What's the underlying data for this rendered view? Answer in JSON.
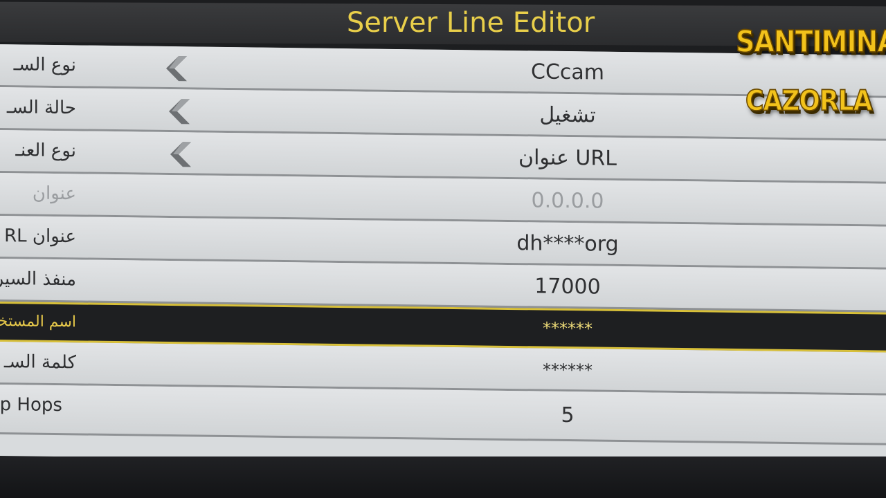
{
  "title": "Server Line Editor",
  "watermark": {
    "line1": "SANTIMINA",
    "line2": "CAZORLA"
  },
  "rows": [
    {
      "label": "نوع السـ",
      "value": "CCcam",
      "has_arrow": true,
      "state": "normal"
    },
    {
      "label": "حالة السـ",
      "value": "تشغيل",
      "has_arrow": true,
      "state": "normal"
    },
    {
      "label": "نوع العنـ",
      "value": "عنوان URL",
      "has_arrow": true,
      "state": "normal"
    },
    {
      "label": "عنوان",
      "value": "0.0.0.0",
      "has_arrow": false,
      "state": "disabled"
    },
    {
      "label": "عنوان RL",
      "value": "dh****org",
      "has_arrow": false,
      "state": "normal"
    },
    {
      "label": "منفذ السير",
      "value": "17000",
      "has_arrow": false,
      "state": "normal"
    },
    {
      "label": "اسم المستخـ",
      "value": "******",
      "has_arrow": false,
      "state": "selected"
    },
    {
      "label": "كلمة السـ",
      "value": "******",
      "has_arrow": false,
      "state": "normal"
    },
    {
      "label": "Jp Hops",
      "value": "5",
      "has_arrow": false,
      "state": "normal"
    }
  ],
  "colors": {
    "title": "#e9cf4a",
    "selected_highlight": "#d8c03a",
    "watermark": "#f2c21b"
  },
  "icons": {
    "left_arrow": "chevron-left-icon"
  }
}
